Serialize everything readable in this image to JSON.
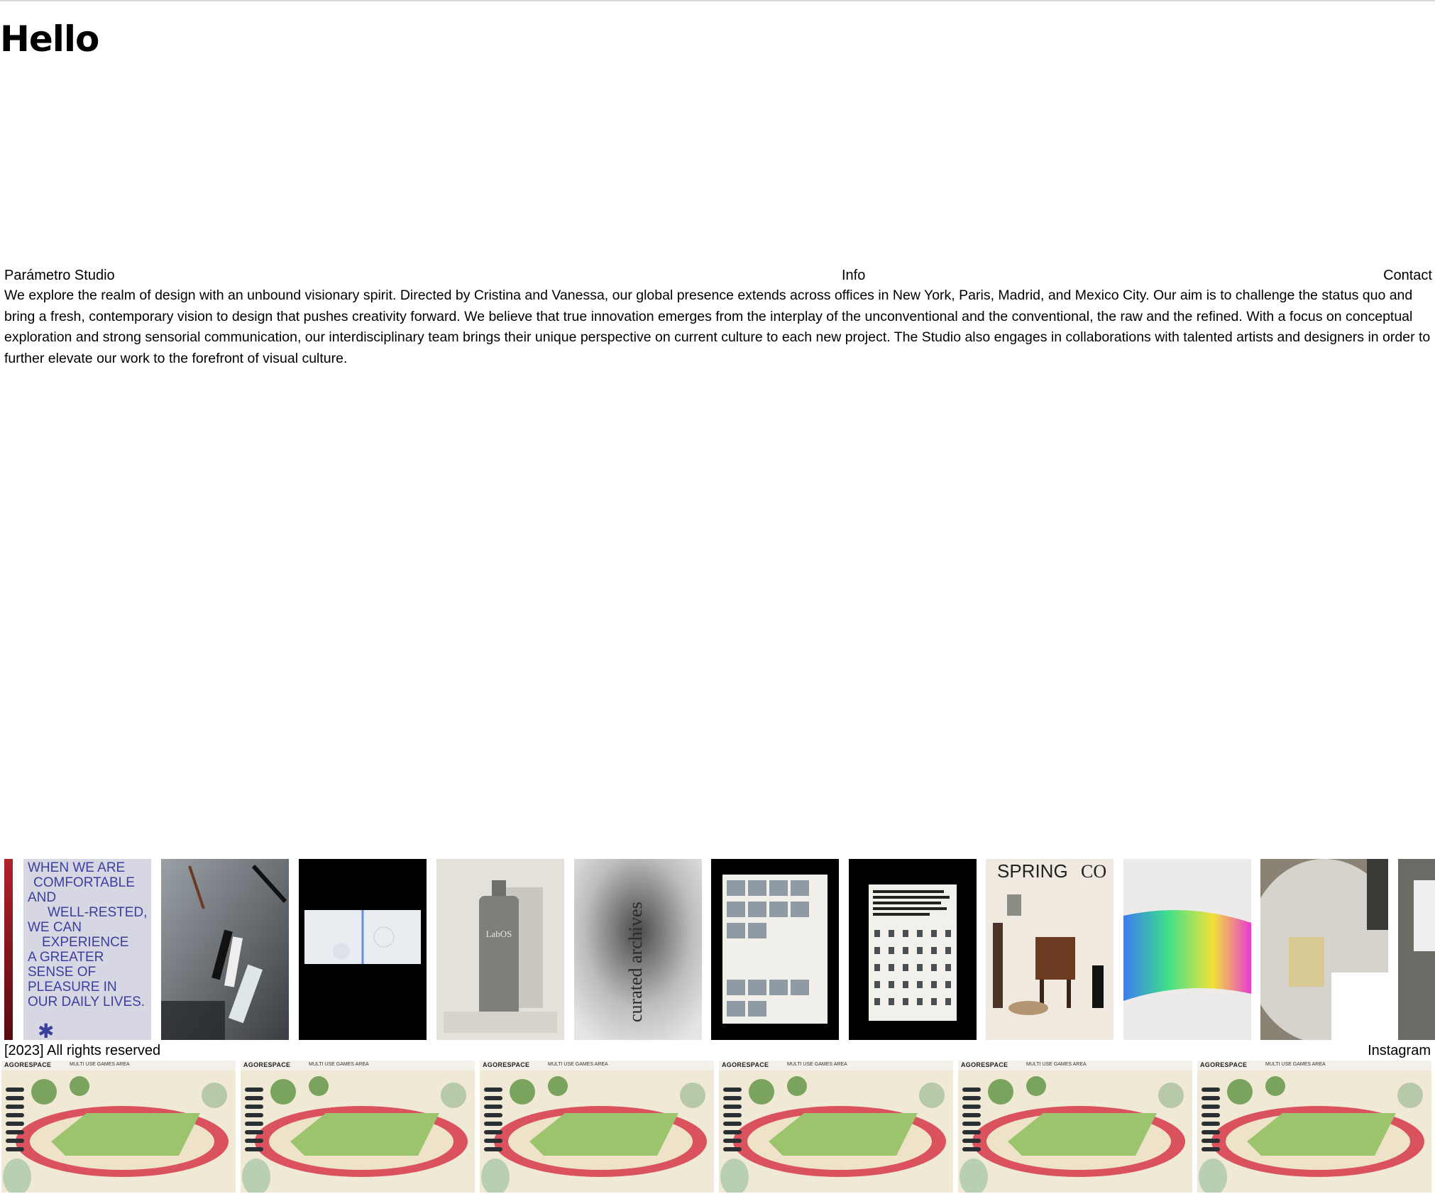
{
  "greeting": "Hello",
  "nav": {
    "brand": "Parámetro Studio",
    "info": "Info",
    "contact": "Contact"
  },
  "intro": "We explore the realm of design with an unbound visionary spirit. Directed by Cristina and Vanessa, our global presence extends across offices in New York, Paris, Madrid, and Mexico City. Our aim is to challenge the status quo and bring a fresh, contemporary vision to design that pushes creativity forward. We believe that true innovation emerges from the interplay of the unconventional and the conventional, the raw and the refined. With a focus on conceptual exploration and strong sensorial communication, our interdisciplinary team brings their unique perspective on current culture to each new project. The Studio also engages in collaborations with talented artists and designers in order to further elevate our work to the forefront of visual culture.",
  "gallery": {
    "poster_text": [
      "WHEN WE ARE",
      "COMFORTABLE",
      "AND",
      "WELL-RESTED,",
      "WE CAN",
      "EXPERIENCE",
      "A GREATER",
      "SENSE OF",
      "PLEASURE IN",
      "OUR DAILY LIVES."
    ],
    "bottle_label": "LabOS",
    "curated_text": "curated archives",
    "spring_text": "SPRING",
    "spring_text_2": "CO"
  },
  "footer": {
    "rights": "[2023] All rights reserved",
    "instagram": "Instagram"
  },
  "bottom_strip": {
    "logo": "AGORESPACE",
    "subtitle": "MULTI USE GAMES AREA"
  },
  "colors": {
    "background": "#ffffff",
    "text": "#000000",
    "poster_blue": "#3b3f9e",
    "track_red": "#d9525e",
    "court_green": "#9cc46c"
  }
}
